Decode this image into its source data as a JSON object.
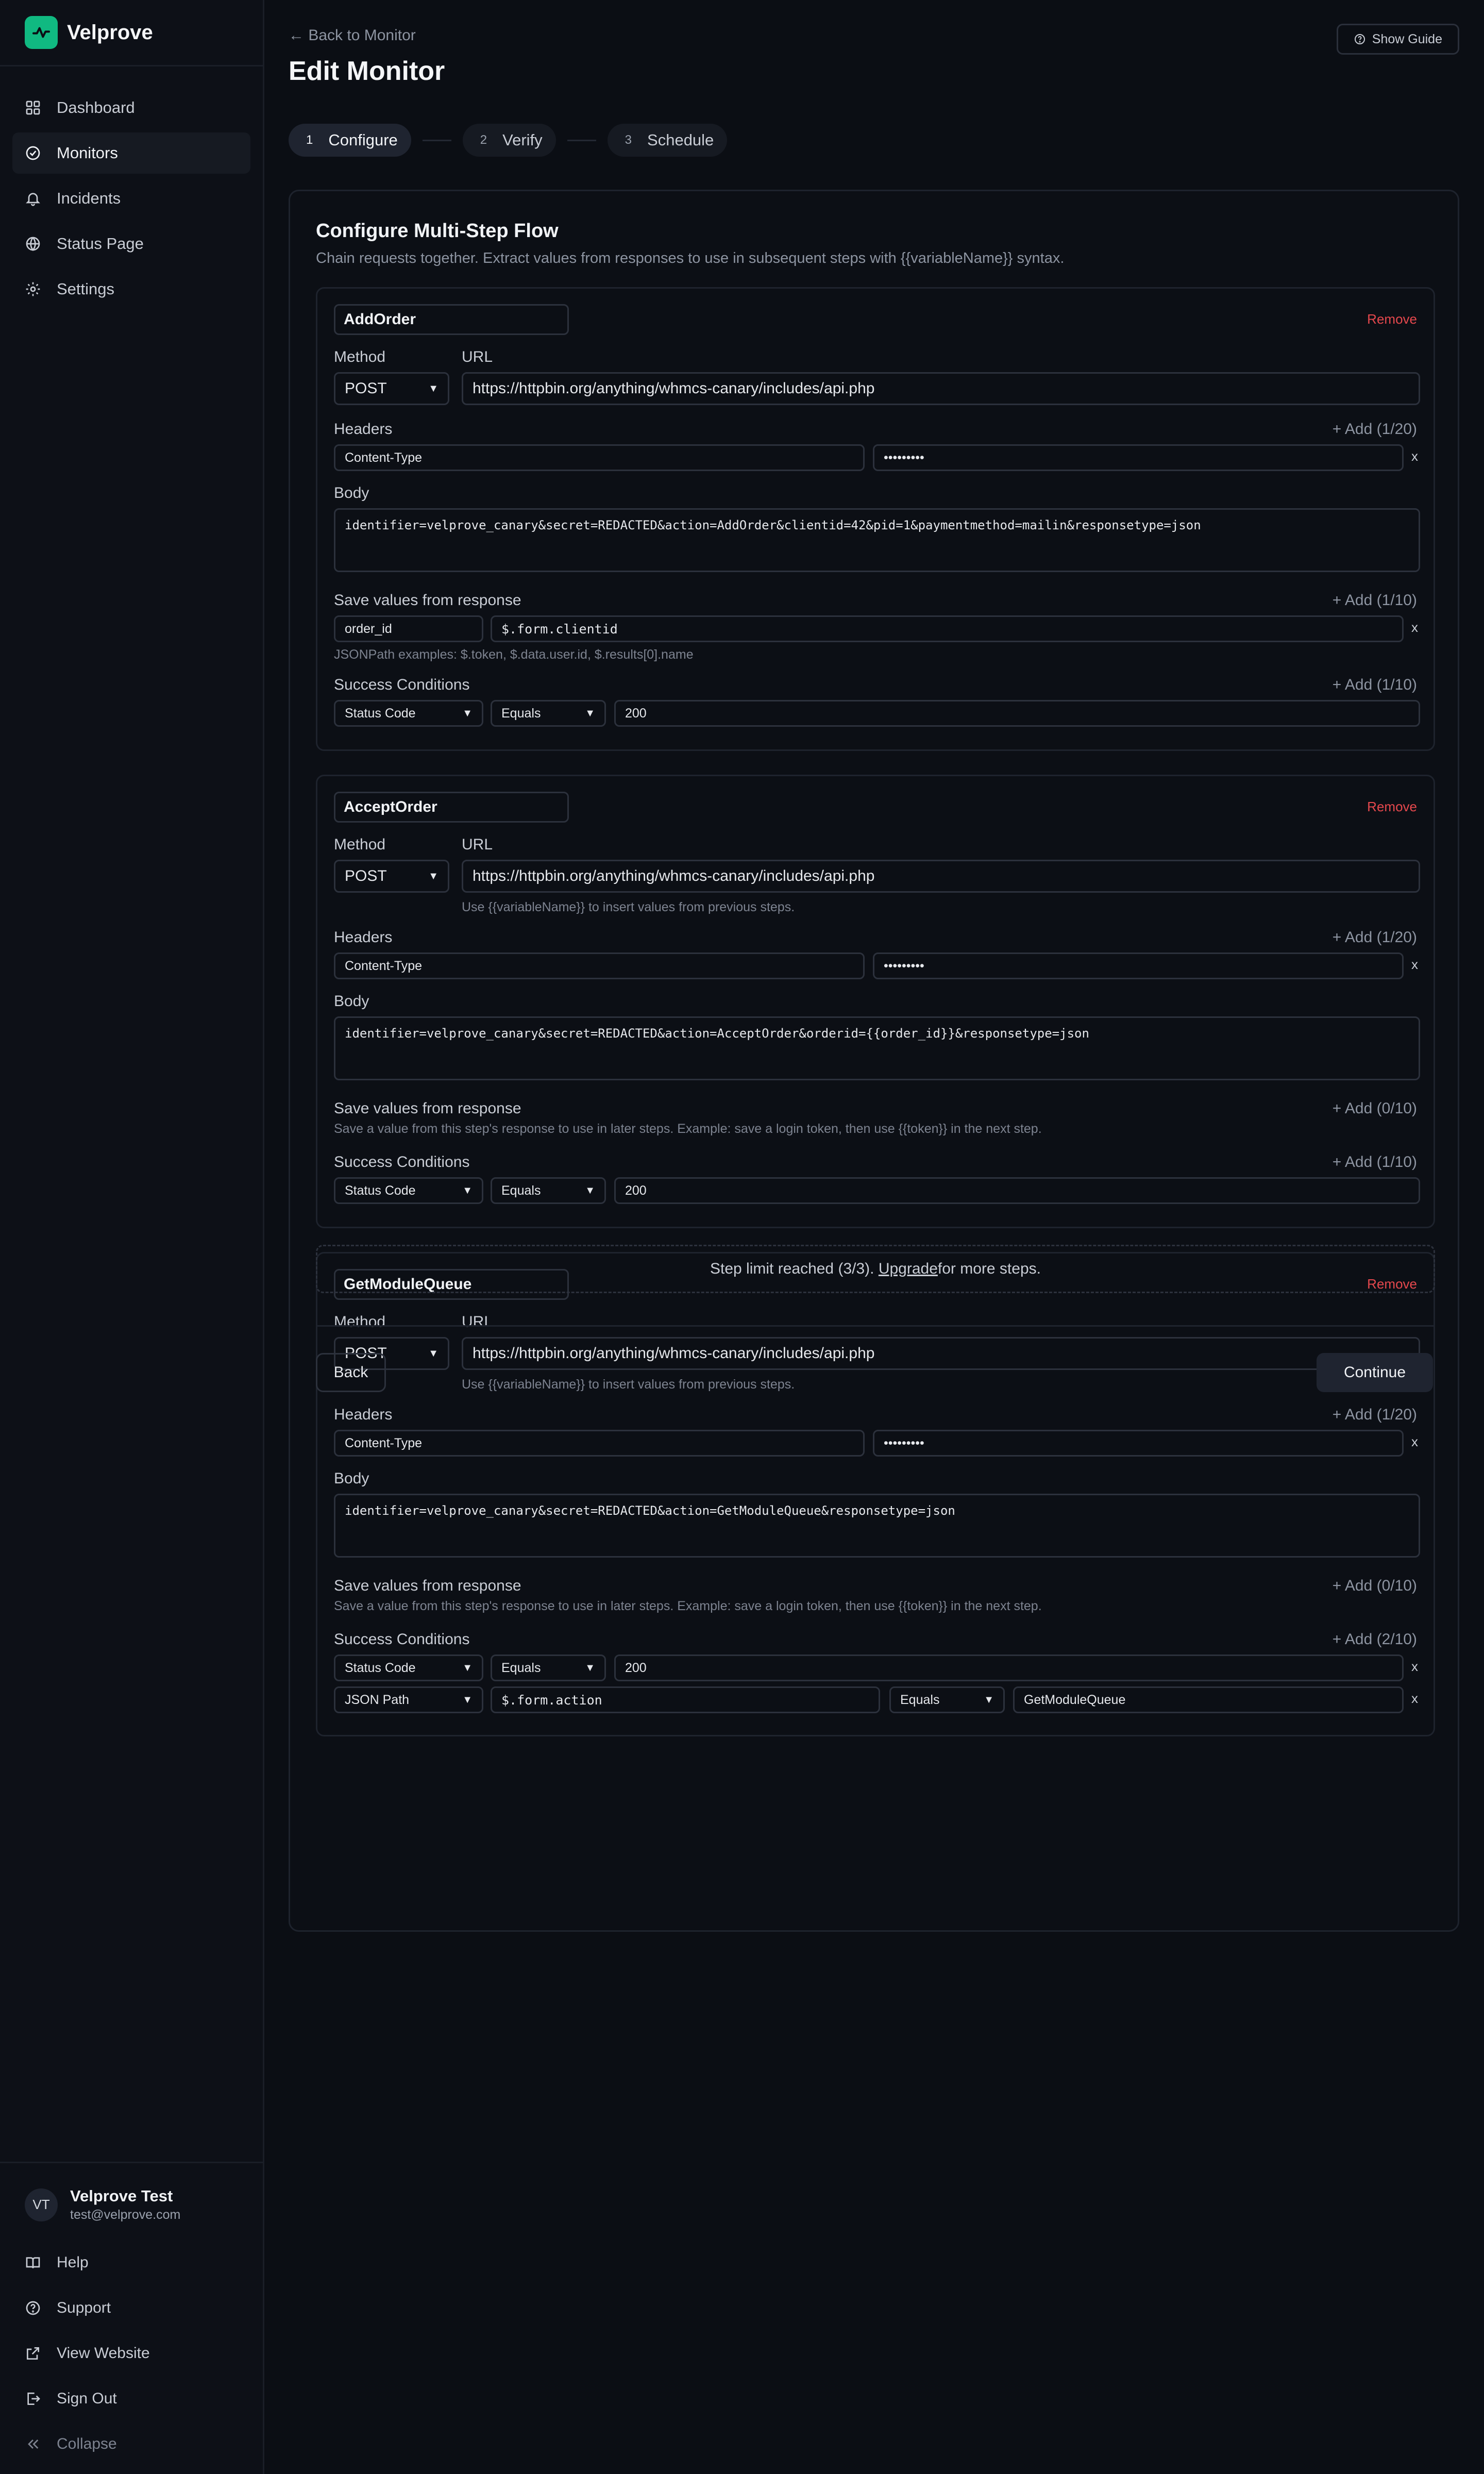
{
  "app": {
    "name": "Velprove"
  },
  "sidebar": {
    "items": [
      {
        "label": "Dashboard",
        "icon": "dashboard-icon"
      },
      {
        "label": "Monitors",
        "icon": "monitor-check-icon",
        "active": true
      },
      {
        "label": "Incidents",
        "icon": "bell-icon"
      },
      {
        "label": "Status Page",
        "icon": "globe-icon"
      },
      {
        "label": "Settings",
        "icon": "gear-icon"
      }
    ],
    "user": {
      "initials": "VT",
      "name": "Velprove Test",
      "email": "test@velprove.com"
    },
    "bottom": [
      {
        "label": "Help",
        "icon": "book-icon"
      },
      {
        "label": "Support",
        "icon": "help-circle-icon"
      },
      {
        "label": "View Website",
        "icon": "external-link-icon"
      },
      {
        "label": "Sign Out",
        "icon": "sign-out-icon"
      },
      {
        "label": "Collapse",
        "icon": "collapse-icon"
      }
    ]
  },
  "header": {
    "back_link": "← Back to Monitor",
    "title": "Edit Monitor",
    "guide_button": "Show Guide"
  },
  "stepper": [
    {
      "num": "1",
      "label": "Configure",
      "active": true
    },
    {
      "num": "2",
      "label": "Verify"
    },
    {
      "num": "3",
      "label": "Schedule"
    }
  ],
  "card": {
    "title": "Configure Multi-Step Flow",
    "subtitle": "Chain requests together. Extract values from responses to use in subsequent steps with {{variableName}} syntax.",
    "labels": {
      "method": "Method",
      "url": "URL",
      "headers": "Headers",
      "body": "Body",
      "save_values": "Save values from response",
      "success_conditions": "Success Conditions",
      "remove": "Remove",
      "x": "x",
      "url_hint": "Use {{variableName}} to insert values from previous steps.",
      "jsonpath_hint": "JSONPath examples: $.token, $.data.user.id, $.results[0].name",
      "save_hint": "Save a value from this step's response to use in later steps. Example: save a login token, then use {{token}} in the next step."
    },
    "steps": [
      {
        "name": "AddOrder",
        "method": "POST",
        "url": "https://httpbin.org/anything/whmcs-canary/includes/api.php",
        "headers_add": "+ Add (1/20)",
        "header_key": "Content-Type",
        "header_value": "•••••••••",
        "body": "identifier=velprove_canary&secret=REDACTED&action=AddOrder&clientid=42&pid=1&paymentmethod=mailin&responsetype=json",
        "save_add": "+ Add (1/10)",
        "save_name": "order_id",
        "save_path": "$.form.clientid",
        "cond_add": "+ Add (1/10)",
        "conditions": [
          {
            "type": "Status Code",
            "op": "Equals",
            "value": "200"
          }
        ]
      },
      {
        "name": "AcceptOrder",
        "method": "POST",
        "url": "https://httpbin.org/anything/whmcs-canary/includes/api.php",
        "headers_add": "+ Add (1/20)",
        "header_key": "Content-Type",
        "header_value": "•••••••••",
        "body": "identifier=velprove_canary&secret=REDACTED&action=AcceptOrder&orderid={{order_id}}&responsetype=json",
        "save_add": "+ Add (0/10)",
        "cond_add": "+ Add (1/10)",
        "conditions": [
          {
            "type": "Status Code",
            "op": "Equals",
            "value": "200"
          }
        ]
      },
      {
        "name": "GetModuleQueue",
        "method": "POST",
        "url": "https://httpbin.org/anything/whmcs-canary/includes/api.php",
        "headers_add": "+ Add (1/20)",
        "header_key": "Content-Type",
        "header_value": "•••••••••",
        "body": "identifier=velprove_canary&secret=REDACTED&action=GetModuleQueue&responsetype=json",
        "save_add": "+ Add (0/10)",
        "cond_add": "+ Add (2/10)",
        "conditions": [
          {
            "type": "Status Code",
            "op": "Equals",
            "value": "200"
          },
          {
            "type": "JSON Path",
            "path": "$.form.action",
            "op": "Equals",
            "value": "GetModuleQueue"
          }
        ]
      }
    ],
    "limit": {
      "prefix": "Step limit reached (3/3). ",
      "link": "Upgrade",
      "suffix": " for more steps."
    },
    "back_button": "Back",
    "continue_button": "Continue"
  },
  "colors": {
    "background": "#0b0e14",
    "brand": "#10b981",
    "danger": "#e5484d"
  }
}
